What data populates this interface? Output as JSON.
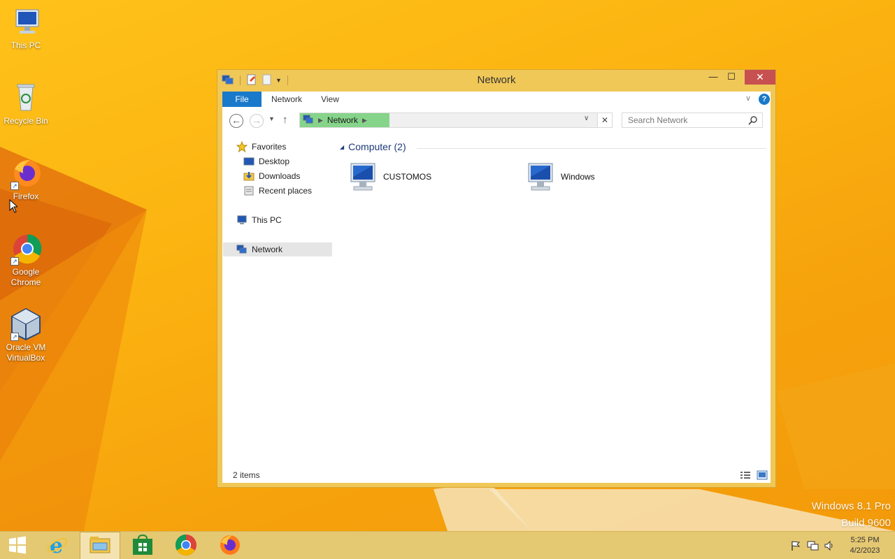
{
  "desktop": {
    "icons": [
      {
        "label": "This PC",
        "icon": "this-pc-icon"
      },
      {
        "label": "Recycle Bin",
        "icon": "recycle-bin-icon"
      },
      {
        "label": "Firefox",
        "icon": "firefox-icon"
      },
      {
        "label": "Google Chrome",
        "icon": "chrome-icon"
      },
      {
        "label": "Oracle VM VirtualBox",
        "icon": "virtualbox-icon"
      }
    ],
    "watermark_line1": "Windows 8.1 Pro",
    "watermark_line2": "Build 9600"
  },
  "window": {
    "title": "Network",
    "ribbon_tabs": [
      "File",
      "Network",
      "View"
    ],
    "address_crumb": "Network",
    "search_placeholder": "Search Network",
    "nav_pane": {
      "favorites": "Favorites",
      "desktop": "Desktop",
      "downloads": "Downloads",
      "recent": "Recent places",
      "this_pc": "This PC",
      "network": "Network"
    },
    "group_title": "Computer (2)",
    "items": [
      {
        "label": "CUSTOMOS",
        "icon": "computer-icon"
      },
      {
        "label": "Windows",
        "icon": "computer-icon"
      }
    ],
    "status": "2 items"
  },
  "taskbar": {
    "pinned": [
      "start-icon",
      "internet-explorer-icon",
      "file-explorer-icon",
      "store-icon",
      "chrome-icon",
      "firefox-icon"
    ],
    "time": "5:25 PM",
    "date": "4/2/2023"
  },
  "colors": {
    "accent": "#1979ca",
    "titlebar": "#f0c858",
    "close": "#c75050",
    "crumb_highlight": "#86d48a",
    "taskbar": "#e5c872"
  }
}
